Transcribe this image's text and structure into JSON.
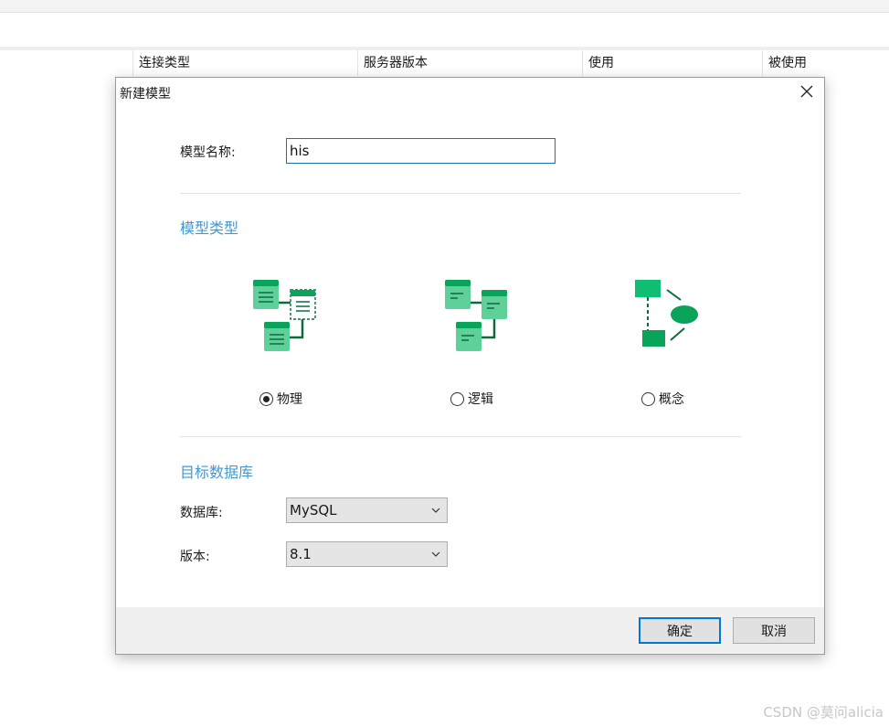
{
  "background": {
    "columns": [
      "连接类型",
      "服务器版本",
      "使用",
      "被使用"
    ],
    "watermark": "CSDN @莫问alicia"
  },
  "dialog": {
    "title": "新建模型",
    "close_icon": "close-icon",
    "name_label": "模型名称:",
    "name_value": "his",
    "model_type_title": "模型类型",
    "model_types": [
      {
        "label": "物理",
        "icon": "physical-model-icon",
        "checked": true
      },
      {
        "label": "逻辑",
        "icon": "logical-model-icon",
        "checked": false
      },
      {
        "label": "概念",
        "icon": "conceptual-model-icon",
        "checked": false
      }
    ],
    "target_db_title": "目标数据库",
    "database_label": "数据库:",
    "database_value": "MySQL",
    "version_label": "版本:",
    "version_value": "8.1",
    "ok_label": "确定",
    "cancel_label": "取消"
  },
  "colors": {
    "accent": "#3d9ad6",
    "icon_green_dark": "#0aa35a",
    "icon_green_light": "#5fd09a",
    "primary_border": "#0078d7"
  }
}
